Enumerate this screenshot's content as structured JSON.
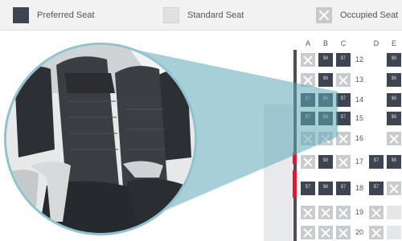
{
  "legend": {
    "preferred_label": "Preferred Seat",
    "standard_label": "Standard Seat",
    "occupied_label": "Occupied Seat"
  },
  "columns": [
    "A",
    "B",
    "C",
    "D",
    "E"
  ],
  "rows": [
    {
      "number": "12",
      "seats": [
        "occupied",
        "preferred",
        "preferred",
        "preferred"
      ]
    },
    {
      "number": "13",
      "seats": [
        "occupied",
        "preferred",
        "occupied",
        "preferred"
      ]
    },
    {
      "number": "14",
      "seats": [
        "preferred",
        "preferred",
        "preferred",
        "preferred"
      ]
    },
    {
      "number": "15",
      "seats": [
        "preferred",
        "preferred",
        "preferred",
        "preferred"
      ]
    },
    {
      "number": "16",
      "seats": [
        "occupied",
        "occupied",
        "occupied",
        "occupied"
      ]
    },
    {
      "number": "17",
      "seats": [
        "occupied",
        "preferred",
        "occupied",
        "preferred",
        "preferred"
      ]
    },
    {
      "number": "18",
      "seats": [
        "preferred",
        "preferred",
        "preferred",
        "preferred",
        "occupied"
      ]
    },
    {
      "number": "19",
      "seats": [
        "occupied",
        "occupied",
        "occupied",
        "occupied",
        "standard"
      ]
    },
    {
      "number": "20",
      "seats": [
        "occupied",
        "occupied",
        "occupied",
        "occupied",
        "standard"
      ]
    }
  ],
  "seat_price": "$7",
  "seat_price_b": "$6",
  "colors": {
    "preferred": "#3f4550",
    "standard": "#e4e6e8",
    "occupied": "#c9cccf",
    "beam": "#5fa8b8",
    "exit": "#d11f2c"
  }
}
